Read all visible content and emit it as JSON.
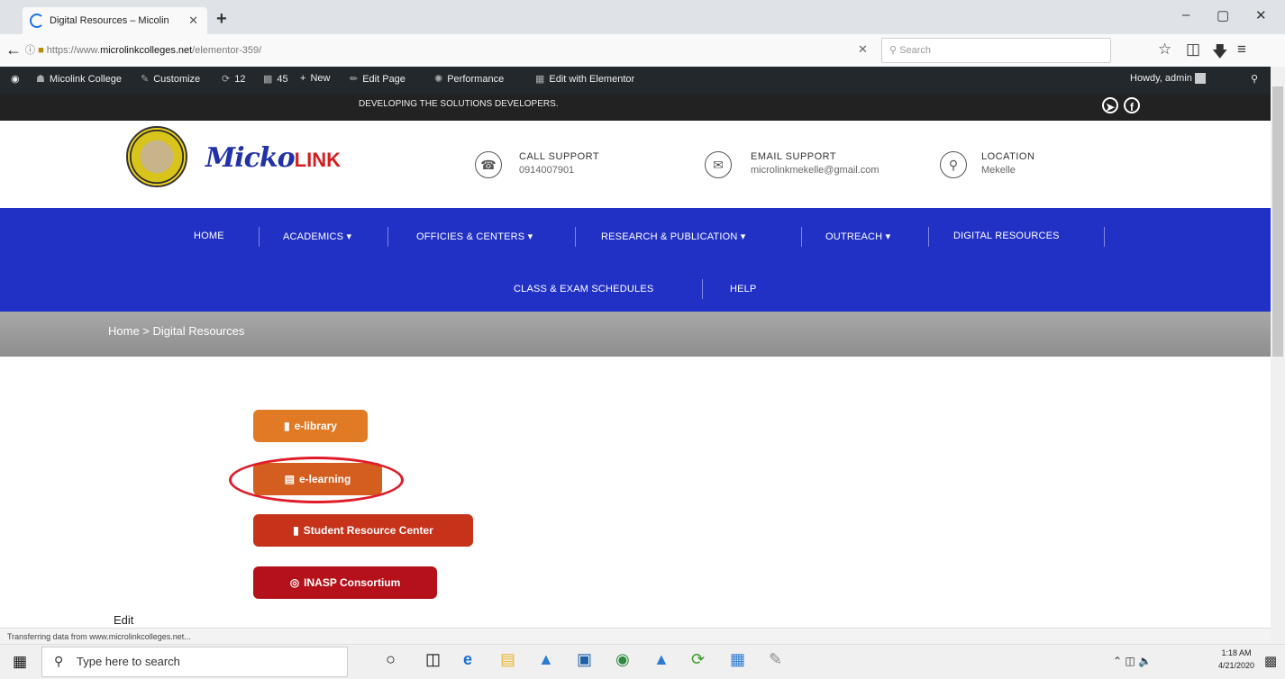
{
  "browser": {
    "tab_title": "Digital Resources – Micolin",
    "tab_close": "✕",
    "new_tab": "+",
    "url_prefix": "https://www.",
    "url_domain": "microlinkcolleges.net",
    "url_path": "/elementor-359/",
    "url_clear": "✕",
    "search_placeholder": "Search",
    "win_minimize": "–",
    "win_maximize": "▢",
    "win_close": "✕"
  },
  "adminbar": {
    "site": "Micolink College",
    "customize": "Customize",
    "updates": "12",
    "comments": "45",
    "new": "New",
    "edit_page": "Edit Page",
    "performance": "Performance",
    "elementor": "Edit with Elementor",
    "howdy": "Howdy, admin"
  },
  "tagline": "DEVELOPING THE SOLUTIONS DEVELOPERS.",
  "header": {
    "logo_main": "Micko",
    "logo_accent": "LINK",
    "call_label": "CALL SUPPORT",
    "call_value": "0914007901",
    "email_label": "EMAIL SUPPORT",
    "email_value": "microlinkmekelle@gmail.com",
    "location_label": "LOCATION",
    "location_value": "Mekelle"
  },
  "menu": {
    "row1": [
      "HOME",
      "ACADEMICS",
      "OFFICIES & CENTERS",
      "RESEARCH & PUBLICATION",
      "OUTREACH",
      "DIGITAL RESOURCES"
    ],
    "row2": [
      "CLASS & EXAM SCHEDULES",
      "HELP"
    ],
    "caret": "▾"
  },
  "breadcrumb": "Home  >  Digital Resources",
  "buttons": {
    "elibrary": "e-library",
    "elearning": "e-learning",
    "student": "Student Resource Center",
    "inasp": "INASP Consortium"
  },
  "colors": {
    "menu_blue": "#2231c5",
    "btn_elibrary": "#e07a25",
    "btn_elearning": "#d45e1f",
    "btn_student": "#c7321b",
    "btn_inasp": "#b4111b",
    "annotation_ring": "#e01c2a"
  },
  "edit_link": "Edit",
  "status_text": "Transferring data from www.microlinkcolleges.net...",
  "taskbar": {
    "search_placeholder": "Type here to search",
    "time": "1:18 AM",
    "date": "4/21/2020"
  }
}
